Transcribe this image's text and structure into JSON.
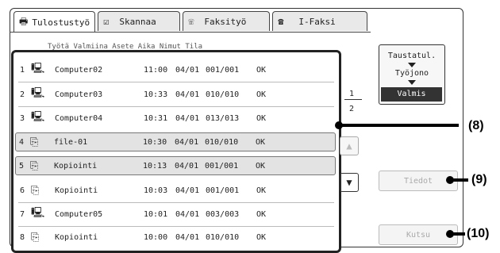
{
  "tabs": [
    {
      "label": "Tulostustyö",
      "icon": "printer-icon",
      "active": true
    },
    {
      "label": "Skannaa",
      "icon": "scanner-icon",
      "active": false
    },
    {
      "label": "Faksityö",
      "icon": "fax-icon",
      "active": false
    },
    {
      "label": "I-Faksi",
      "icon": "internet-fax-icon",
      "active": false
    }
  ],
  "columns": {
    "text": "Työtä Valmiina Asete Aika Nimut Tila"
  },
  "jobs": [
    {
      "num": "1",
      "icon": "computer-icon",
      "name": "Computer02",
      "time": "11:00",
      "date": "04/01",
      "count": "001/001",
      "status": "OK"
    },
    {
      "num": "2",
      "icon": "computer-icon",
      "name": "Computer03",
      "time": "10:33",
      "date": "04/01",
      "count": "010/010",
      "status": "OK"
    },
    {
      "num": "3",
      "icon": "computer-icon",
      "name": "Computer04",
      "time": "10:31",
      "date": "04/01",
      "count": "013/013",
      "status": "OK"
    },
    {
      "num": "4",
      "icon": "copy-icon",
      "name": "file-01",
      "time": "10:30",
      "date": "04/01",
      "count": "010/010",
      "status": "OK"
    },
    {
      "num": "5",
      "icon": "copy-icon",
      "name": "Kopiointi",
      "time": "10:13",
      "date": "04/01",
      "count": "001/001",
      "status": "OK"
    },
    {
      "num": "6",
      "icon": "copy-icon",
      "name": "Kopiointi",
      "time": "10:03",
      "date": "04/01",
      "count": "001/001",
      "status": "OK"
    },
    {
      "num": "7",
      "icon": "computer-icon",
      "name": "Computer05",
      "time": "10:01",
      "date": "04/01",
      "count": "003/003",
      "status": "OK"
    },
    {
      "num": "8",
      "icon": "copy-icon",
      "name": "Kopiointi",
      "time": "10:00",
      "date": "04/01",
      "count": "010/010",
      "status": "OK"
    }
  ],
  "pager": {
    "current": "1",
    "total": "2"
  },
  "status_selector": {
    "line1": "Taustatul.",
    "line2": "Työjono",
    "selected": "Valmis"
  },
  "buttons": {
    "details": "Tiedot",
    "call": "Kutsu"
  },
  "callouts": {
    "c8": "(8)",
    "c9": "(9)",
    "c10": "(10)"
  }
}
